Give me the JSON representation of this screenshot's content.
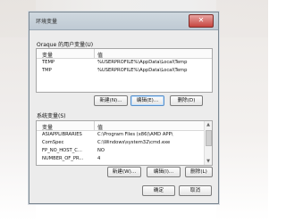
{
  "window": {
    "title": "环境变量",
    "close_icon": "✕"
  },
  "user_vars": {
    "group_label": "Oraque 的用户变量(U)",
    "columns": [
      "变量",
      "值"
    ],
    "rows": [
      {
        "name": "TEMP",
        "value": "%USERPROFILE%\\AppData\\Local\\Temp"
      },
      {
        "name": "TMP",
        "value": "%USERPROFILE%\\AppData\\Local\\Temp"
      }
    ],
    "buttons": {
      "new": "新建(N)...",
      "edit": "编辑(E)...",
      "delete": "删除(D)"
    }
  },
  "system_vars": {
    "group_label": "系统变量(S)",
    "columns": [
      "变量",
      "值"
    ],
    "rows": [
      {
        "name": "ASIAPPLIBRARIES",
        "value": "C:\\Program Files (x86)\\AMD APP\\"
      },
      {
        "name": "ComSpec",
        "value": "C:\\Windows\\system32\\cmd.exe"
      },
      {
        "name": "FP_NO_HOST_C...",
        "value": "NO"
      },
      {
        "name": "NUMBER_OF_PR...",
        "value": "4"
      }
    ],
    "buttons": {
      "new": "新建(W)...",
      "edit": "编辑(I)...",
      "delete": "删除(L)"
    }
  },
  "footer": {
    "ok": "确定",
    "cancel": "取消"
  }
}
